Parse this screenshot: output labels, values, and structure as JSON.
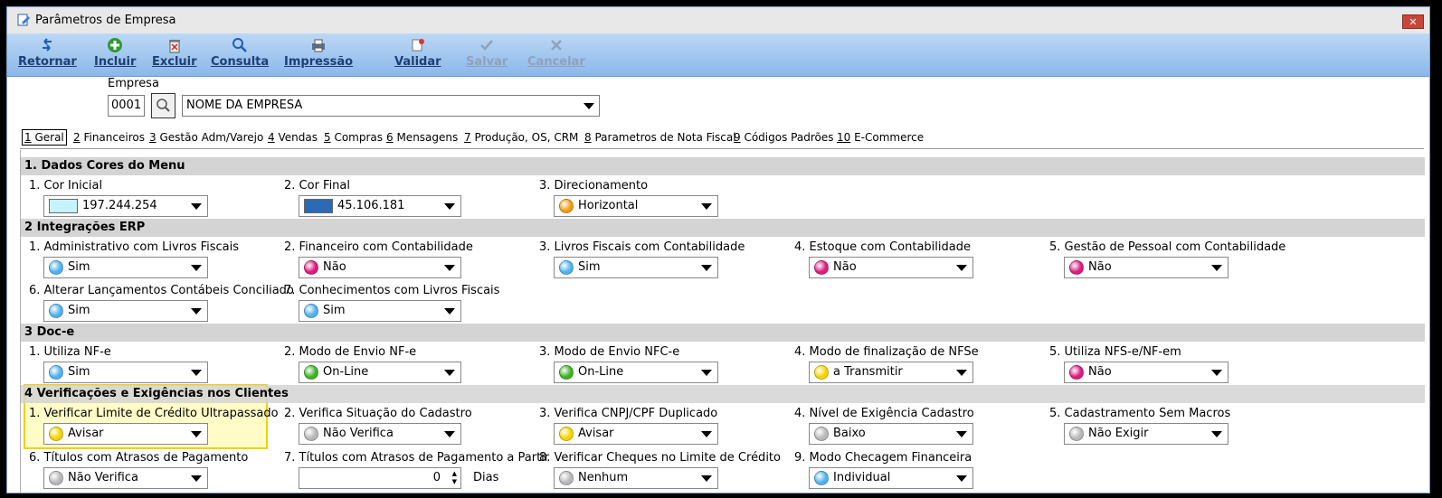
{
  "window": {
    "title": "Parâmetros de Empresa",
    "close_label": "✕"
  },
  "toolbar": {
    "retornar": "Retornar",
    "incluir": "Incluir",
    "excluir": "Excluir",
    "consulta": "Consulta",
    "impressao": "Impressão",
    "validar": "Validar",
    "salvar": "Salvar",
    "cancelar": "Cancelar"
  },
  "empresa": {
    "label": "Empresa",
    "code": "0001",
    "name": "NOME DA EMPRESA"
  },
  "tabs": [
    {
      "num": "1",
      "label": " Geral"
    },
    {
      "num": "2",
      "label": " Financeiros"
    },
    {
      "num": "3",
      "label": " Gestão Adm/Varejo"
    },
    {
      "num": "4",
      "label": " Vendas"
    },
    {
      "num": "5",
      "label": " Compras"
    },
    {
      "num": "6",
      "label": " Mensagens"
    },
    {
      "num": "7",
      "label": " Produção, OS, CRM"
    },
    {
      "num": "8",
      "label": " Parametros de Nota Fiscal"
    },
    {
      "num": "9",
      "label": " Códigos Padrões"
    },
    {
      "num": "10",
      "label": " E-Commerce"
    }
  ],
  "sections": {
    "s1": "1.  Dados Cores do Menu",
    "s2": "2 Integrações ERP",
    "s3": "3  Doc-e",
    "s4": "4 Verificações e Exigências nos Clientes"
  },
  "fields": {
    "cor_inicial": {
      "label": "1. Cor Inicial",
      "value": "197.244.254",
      "color": "#c5f4fe"
    },
    "cor_final": {
      "label": "2. Cor Final",
      "value": "45.106.181",
      "color": "#2d6ab5"
    },
    "direcionamento": {
      "label": "3. Direcionamento",
      "value": "Horizontal",
      "color": "#f39c12"
    },
    "adm_livros": {
      "label": "1. Administrativo com Livros Fiscais",
      "value": "Sim",
      "color": "#4fb3f0"
    },
    "fin_contab": {
      "label": "2. Financeiro com Contabilidade",
      "value": "Não",
      "color": "#e0197d"
    },
    "livros_contab": {
      "label": "3. Livros Fiscais com Contabilidade",
      "value": "Sim",
      "color": "#4fb3f0"
    },
    "estoque_contab": {
      "label": "4. Estoque com Contabilidade",
      "value": "Não",
      "color": "#e0197d"
    },
    "pessoal_contab": {
      "label": "5. Gestão de Pessoal com Contabilidade",
      "value": "Não",
      "color": "#e0197d"
    },
    "alterar_lanc": {
      "label": "6. Alterar Lançamentos Contábeis Conciliado",
      "value": "Sim",
      "color": "#4fb3f0"
    },
    "conhecimentos": {
      "label": "7. Conhecimentos com Livros Fiscais",
      "value": "Sim",
      "color": "#4fb3f0"
    },
    "utiliza_nfe": {
      "label": "1. Utiliza NF-e",
      "value": "Sim",
      "color": "#4fb3f0"
    },
    "modo_nfe": {
      "label": "2. Modo de Envio NF-e",
      "value": "On-Line",
      "color": "#3cb521"
    },
    "modo_nfce": {
      "label": "3. Modo de Envio NFC-e",
      "value": "On-Line",
      "color": "#3cb521"
    },
    "final_nfse": {
      "label": "4. Modo de finalização de NFSe",
      "value": "a Transmitir",
      "color": "#f5d400"
    },
    "utiliza_nfse": {
      "label": "5. Utiliza NFS-e/NF-em",
      "value": "Não",
      "color": "#e0197d"
    },
    "limite_credito": {
      "label": "1. Verificar Limite de Crédito Ultrapassado",
      "value": "Avisar",
      "color": "#f5d400"
    },
    "situacao_cadastro": {
      "label": "2. Verifica Situação do Cadastro",
      "value": "Não Verifica",
      "color": "#b8b8b8"
    },
    "cnpj_dup": {
      "label": "3. Verifica CNPJ/CPF Duplicado",
      "value": "Avisar",
      "color": "#f5d400"
    },
    "nivel_exig": {
      "label": "4. Nível de Exigência Cadastro",
      "value": "Baixo",
      "color": "#b8b8b8"
    },
    "sem_macros": {
      "label": "5. Cadastramento Sem Macros",
      "value": "Não Exigir",
      "color": "#b8b8b8"
    },
    "titulos_atraso": {
      "label": "6. Títulos com Atrasos de Pagamento",
      "value": "Não Verifica",
      "color": "#b8b8b8"
    },
    "titulos_partir": {
      "label": "7. Títulos com Atrasos de Pagamento a Partir",
      "value": "0",
      "unit": "Dias"
    },
    "cheques_limite": {
      "label": "8. Verificar Cheques no Limite de Crédito",
      "value": "Nenhum",
      "color": "#b8b8b8"
    },
    "checagem_fin": {
      "label": "9. Modo Checagem Financeira",
      "value": "Individual",
      "color": "#4fb3f0"
    }
  }
}
